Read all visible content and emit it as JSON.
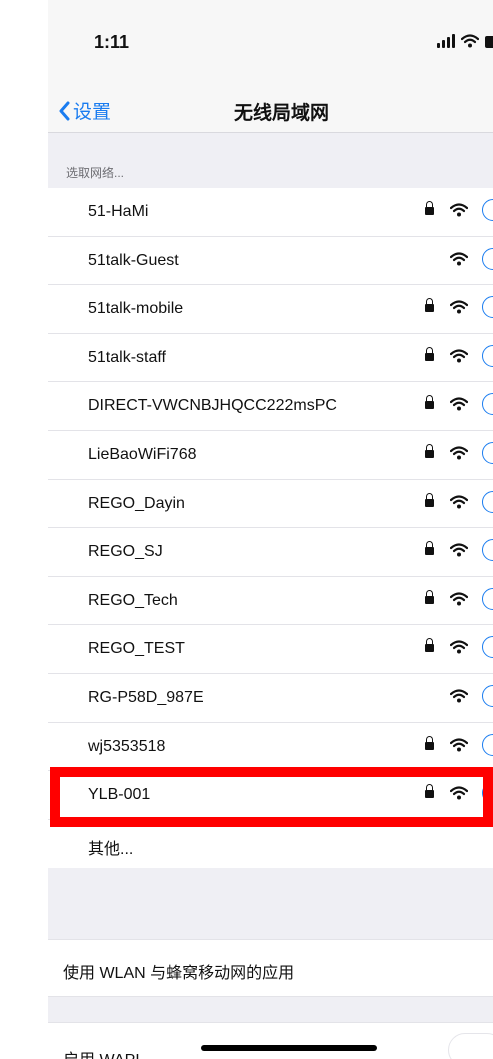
{
  "status_bar": {
    "time": "1:11"
  },
  "nav": {
    "back_label": "设置",
    "title": "无线局域网"
  },
  "section": {
    "header": "选取网络..."
  },
  "networks": [
    {
      "name": "51-HaMi",
      "locked": true
    },
    {
      "name": "51talk-Guest",
      "locked": false
    },
    {
      "name": "51talk-mobile",
      "locked": true
    },
    {
      "name": "51talk-staff",
      "locked": true
    },
    {
      "name": "DIRECT-VWCNBJHQCC222msPC",
      "locked": true
    },
    {
      "name": "LieBaoWiFi768",
      "locked": true
    },
    {
      "name": "REGO_Dayin",
      "locked": true
    },
    {
      "name": "REGO_SJ",
      "locked": true
    },
    {
      "name": "REGO_Tech",
      "locked": true
    },
    {
      "name": "REGO_TEST",
      "locked": true
    },
    {
      "name": "RG-P58D_987E",
      "locked": false
    },
    {
      "name": "wj5353518",
      "locked": true
    },
    {
      "name": "YLB-001",
      "locked": true
    }
  ],
  "other_label": "其他...",
  "apps_label": "使用 WLAN 与蜂窝移动网的应用",
  "bottom_label": "启用 WAPI",
  "colors": {
    "accent": "#1a7cf0",
    "highlight": "#ff0000"
  },
  "icons": {
    "back": "chevron-left-icon",
    "lock": "lock-icon",
    "wifi": "wifi-icon",
    "info": "info-icon"
  }
}
